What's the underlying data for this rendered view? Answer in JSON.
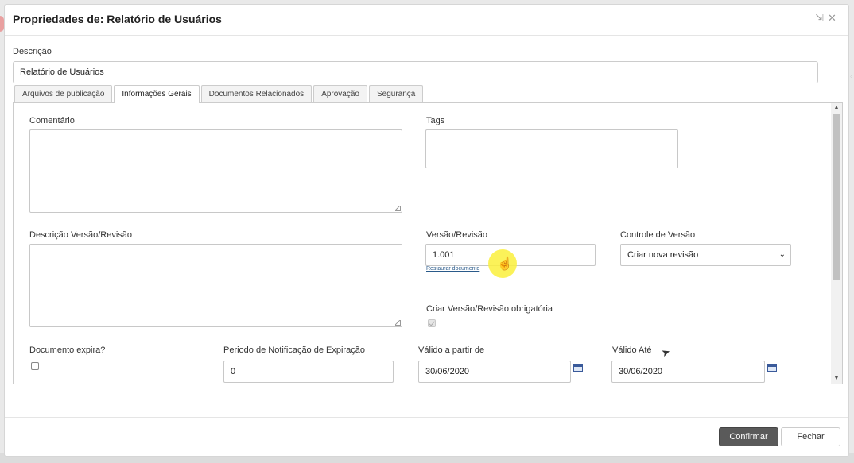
{
  "dialog": {
    "title": "Propriedades de: Relatório de Usuários"
  },
  "description": {
    "label": "Descrição",
    "value": "Relatório de Usuários"
  },
  "tabs": [
    {
      "label": "Arquivos de publicação",
      "active": false
    },
    {
      "label": "Informações Gerais",
      "active": true
    },
    {
      "label": "Documentos Relacionados",
      "active": false
    },
    {
      "label": "Aprovação",
      "active": false
    },
    {
      "label": "Segurança",
      "active": false
    }
  ],
  "form": {
    "comment_label": "Comentário",
    "comment_value": "",
    "tags_label": "Tags",
    "tags_value": "",
    "version_desc_label": "Descrição Versão/Revisão",
    "version_desc_value": "",
    "version_label": "Versão/Revisão",
    "version_value": "1.001",
    "restore_link": "Restaurar documento",
    "version_control_label": "Controle de Versão",
    "version_control_value": "Criar nova revisão",
    "mandatory_label": "Criar Versão/Revisão obrigatória",
    "mandatory_checked": true,
    "expires_label": "Documento expira?",
    "expires_checked": false,
    "notif_period_label": "Periodo de Notificação de Expiração",
    "notif_period_value": "0",
    "valid_from_label": "Válido a partir de",
    "valid_from_value": "30/06/2020",
    "valid_until_label": "Válido Até",
    "valid_until_value": "30/06/2020"
  },
  "footer": {
    "confirm_label": "Confirmar",
    "close_label": "Fechar"
  },
  "colors": {
    "primary_button": "#5a5a5a",
    "cursor_highlight": "#faf03c"
  }
}
